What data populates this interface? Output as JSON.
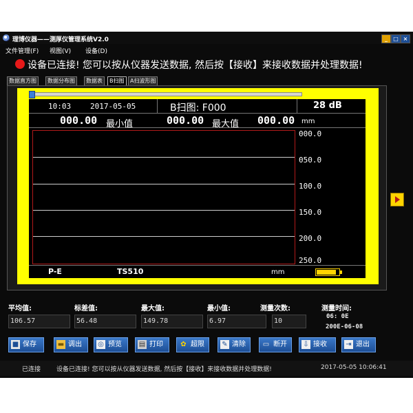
{
  "window": {
    "title": "理博仪器——测厚仪管理系统V2.0",
    "controls": [
      "_",
      "□",
      "×"
    ]
  },
  "menu": [
    "文件管理(F)",
    "视图(V)",
    "设备(D)"
  ],
  "status_message": "设备已连接! 您可以按从仪器发送数据, 然后按【接收】来接收数据并处理数据!",
  "tabs": [
    "数据直方图",
    "数据分布图",
    "数据表",
    "B扫图",
    "A扫波形图"
  ],
  "active_tab": "B扫图",
  "scope": {
    "time": "10:03",
    "date": "2017-05-05",
    "title": "B扫图: F000",
    "gain": "28 dB",
    "min_value": "000.00",
    "min_label": "最小值",
    "max_value": "000.00",
    "max_label": "最大值",
    "current_value": "000.00",
    "unit": "mm",
    "y_ticks": [
      "000.0",
      "050.0",
      "100.0",
      "150.0",
      "200.0",
      "250.0"
    ],
    "mode": "P-E",
    "probe": "TS510",
    "foot_unit": "mm"
  },
  "stats": {
    "avg_label": "平均值:",
    "avg": "106.57",
    "std_label": "标差值:",
    "std": "56.48",
    "max_label": "最大值:",
    "max": "149.78",
    "min_label": "最小值:",
    "min": "6.97",
    "count_label": "测量次数:",
    "count": "10",
    "time_label": "测量时间:",
    "time_value": "06: 0E",
    "date_value": "200E-06-08"
  },
  "buttons": [
    {
      "label": "保存",
      "icon": "save-icon"
    },
    {
      "label": "调出",
      "icon": "folder-icon"
    },
    {
      "label": "预览",
      "icon": "preview-icon"
    },
    {
      "label": "打印",
      "icon": "printer-icon"
    },
    {
      "label": "超限",
      "icon": "limit-icon"
    },
    {
      "label": "清除",
      "icon": "clear-icon"
    },
    {
      "label": "断开",
      "icon": "disconnect-icon"
    },
    {
      "label": "接收",
      "icon": "receive-icon"
    },
    {
      "label": "退出",
      "icon": "exit-icon"
    }
  ],
  "statusbar": {
    "state": "已连接",
    "message": "设备已连接! 您可以按从仪器发送数据, 然后按【接收】来接收数据并处理数据!",
    "datetime": "2017-05-05 10:06:41"
  },
  "colors": {
    "accent": "#ffff00",
    "background": "#0b0b0b",
    "button": "#2a64b4",
    "status_dot": "#e61919"
  }
}
